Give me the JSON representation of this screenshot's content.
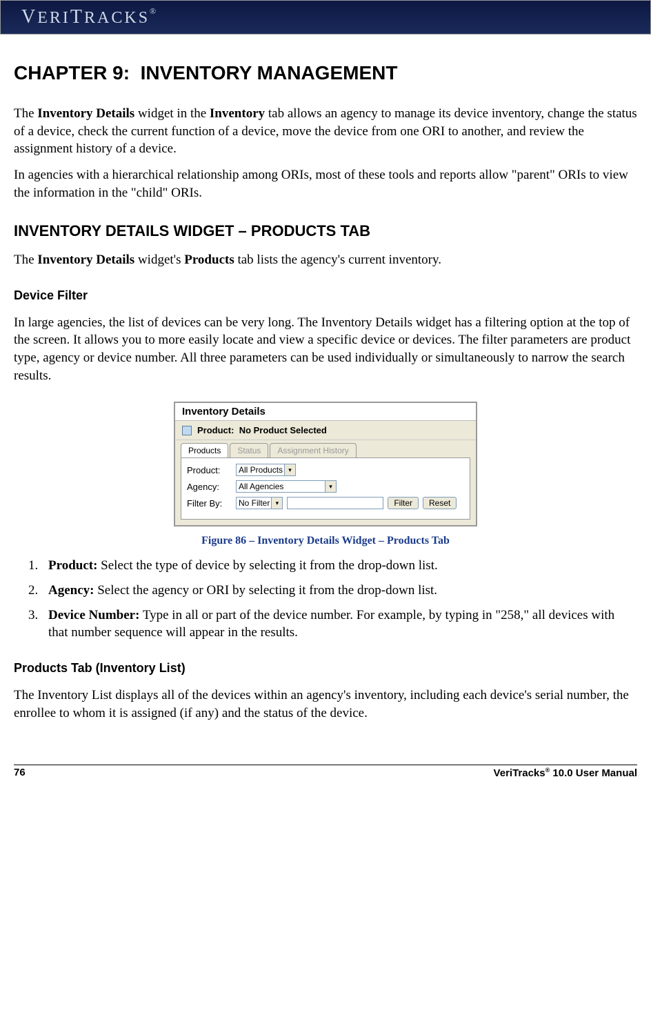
{
  "header": {
    "logo": "VERITRACKS",
    "reg": "®"
  },
  "chapter": {
    "prefix": "CHAPTER",
    "number": "9:",
    "title": "INVENTORY MANAGEMENT"
  },
  "paragraphs": {
    "intro1_pre": "The ",
    "intro1_b1": "Inventory Details",
    "intro1_mid": " widget in the ",
    "intro1_b2": "Inventory",
    "intro1_post": " tab allows an agency to manage its device inventory, change the status of a device, check the current function of a device, move the device from one ORI to another, and review the assignment history of a device.",
    "intro2": "In agencies with a hierarchical relationship among ORIs, most of these tools and reports allow \"parent\" ORIs to view the information in the \"child\" ORIs.",
    "h2": "INVENTORY DETAILS WIDGET – PRODUCTS TAB",
    "p2_pre": "The ",
    "p2_b1": "Inventory Details",
    "p2_mid": " widget's ",
    "p2_b2": "Products",
    "p2_post": " tab lists the agency's current inventory.",
    "h3_filter": "Device Filter",
    "filter_para": "In large agencies, the list of devices can be very long. The Inventory Details widget has a filtering option at the top of the screen. It allows you to more easily locate and view a specific device or devices. The filter parameters are product type, agency or device number. All three parameters can be used individually or simultaneously to narrow the search results.",
    "h3_list": "Products Tab (Inventory List)",
    "list_para": "The Inventory List displays all of the devices within an agency's inventory, including each device's serial number, the enrollee to whom it is assigned (if any) and the status of the device."
  },
  "widget": {
    "title": "Inventory Details",
    "subtitle_label": "Product:",
    "subtitle_value": "No Product Selected",
    "tabs": {
      "products": "Products",
      "status": "Status",
      "history": "Assignment History"
    },
    "form": {
      "product_label": "Product:",
      "product_value": "All Products",
      "agency_label": "Agency:",
      "agency_value": "All Agencies",
      "filterby_label": "Filter By:",
      "filterby_value": "No Filter",
      "filter_btn": "Filter",
      "reset_btn": "Reset"
    }
  },
  "figure_caption": "Figure 86 – Inventory Details Widget – Products Tab",
  "steps": [
    {
      "b": "Product:",
      "t": " Select the type of device by selecting it from the drop-down list."
    },
    {
      "b": "Agency:",
      "t": " Select the agency or ORI by selecting it from the drop-down list."
    },
    {
      "b": "Device Number:",
      "t": " Type in all or part of the device number. For example, by typing in \"258,\" all devices with that number sequence will appear in the results."
    }
  ],
  "footer": {
    "page": "76",
    "manual_pre": "VeriTracks",
    "manual_sup": "®",
    "manual_post": " 10.0 User Manual"
  }
}
